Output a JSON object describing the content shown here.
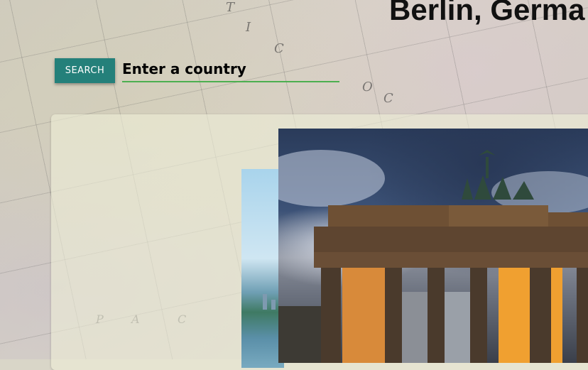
{
  "header": {
    "title": "Berlin, Germa"
  },
  "search": {
    "button_label": "SEARCH",
    "placeholder": "Enter a country"
  },
  "background": {
    "map_labels": [
      "T",
      "I",
      "C",
      "O",
      "C",
      "P",
      "A",
      "C"
    ]
  },
  "colors": {
    "accent": "#24807a",
    "input_underline": "#4caf50",
    "card_bg": "#eeeed6"
  },
  "photos": {
    "main": "brandenburg-gate-photo",
    "secondary": "city-river-photo"
  }
}
